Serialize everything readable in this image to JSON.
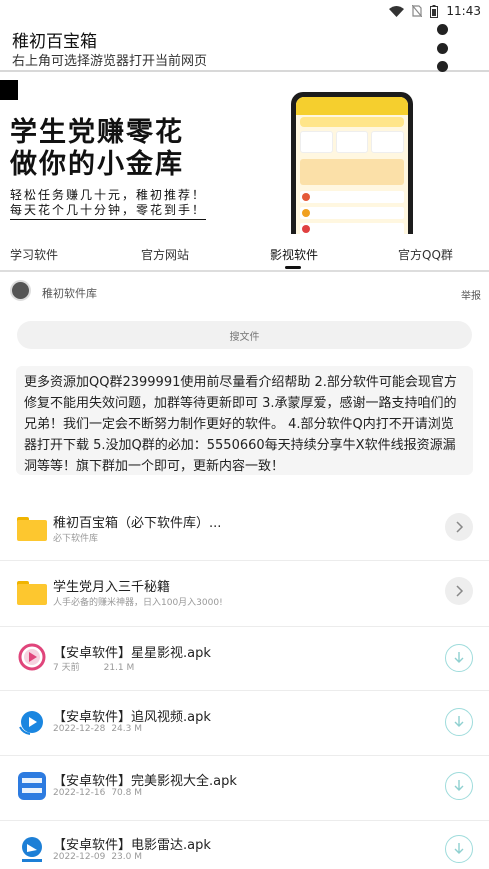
{
  "status_bar": {
    "time": "11:43"
  },
  "header": {
    "title": "稚初百宝箱",
    "subtitle": "右上角可选择游览器打开当前网页"
  },
  "banner": {
    "headline_1": "学生党赚零花",
    "headline_2": "做你的小金库",
    "line_1": "轻松任务赚几十元，稚初推荐！",
    "line_2": "每天花个几十分钟，零花到手！"
  },
  "tabs": [
    {
      "label": "学习软件"
    },
    {
      "label": "官方网站"
    },
    {
      "label": "影视软件"
    },
    {
      "label": "官方QQ群"
    }
  ],
  "active_tab": "影视软件",
  "account": {
    "name": "稚初软件库",
    "report_label": "举报"
  },
  "search": {
    "placeholder": "搜文件"
  },
  "notice": "更多资源加QQ群2399991使用前尽量看介绍帮助 2.部分软件可能会现官方修复不能用失效问题，加群等待更新即可 3.承蒙厚爱，感谢一路支持咱们的兄弟！我们一定会不断努力制作更好的软件。 4.部分软件Q内打不开请浏览器打开下载 5.没加Q群的必加：5550660每天持续分享牛X软件线报资源漏洞等等！旗下群加一个即可，更新内容一致！",
  "folders": [
    {
      "title": "稚初百宝箱（必下软件库）...",
      "subtitle": "必下软件库"
    },
    {
      "title": "学生党月入三千秘籍",
      "subtitle": "人手必备的赚米神器，日入100月入3000!"
    }
  ],
  "files": [
    {
      "title": "【安卓软件】星星影视.apk",
      "date": "7 天前",
      "size": "21.1 M",
      "icon": "xingxing-video-icon",
      "color": "#e0457b"
    },
    {
      "title": "【安卓软件】追风视频.apk",
      "date": "2022-12-28",
      "size": "24.3 M",
      "icon": "zhuifeng-video-icon",
      "color": "#1a86e0"
    },
    {
      "title": "【安卓软件】完美影视大全.apk",
      "date": "2022-12-16",
      "size": "70.8 M",
      "icon": "wanmei-video-icon",
      "color": "#2d7be0"
    },
    {
      "title": "【安卓软件】电影雷达.apk",
      "date": "2022-12-09",
      "size": "23.0 M",
      "icon": "movie-radar-icon",
      "color": "#1d7fd6"
    }
  ],
  "colors": {
    "accent_download": "#9fdcdc",
    "folder": "#fdc72f",
    "phone_header": "#f5cf2e"
  }
}
